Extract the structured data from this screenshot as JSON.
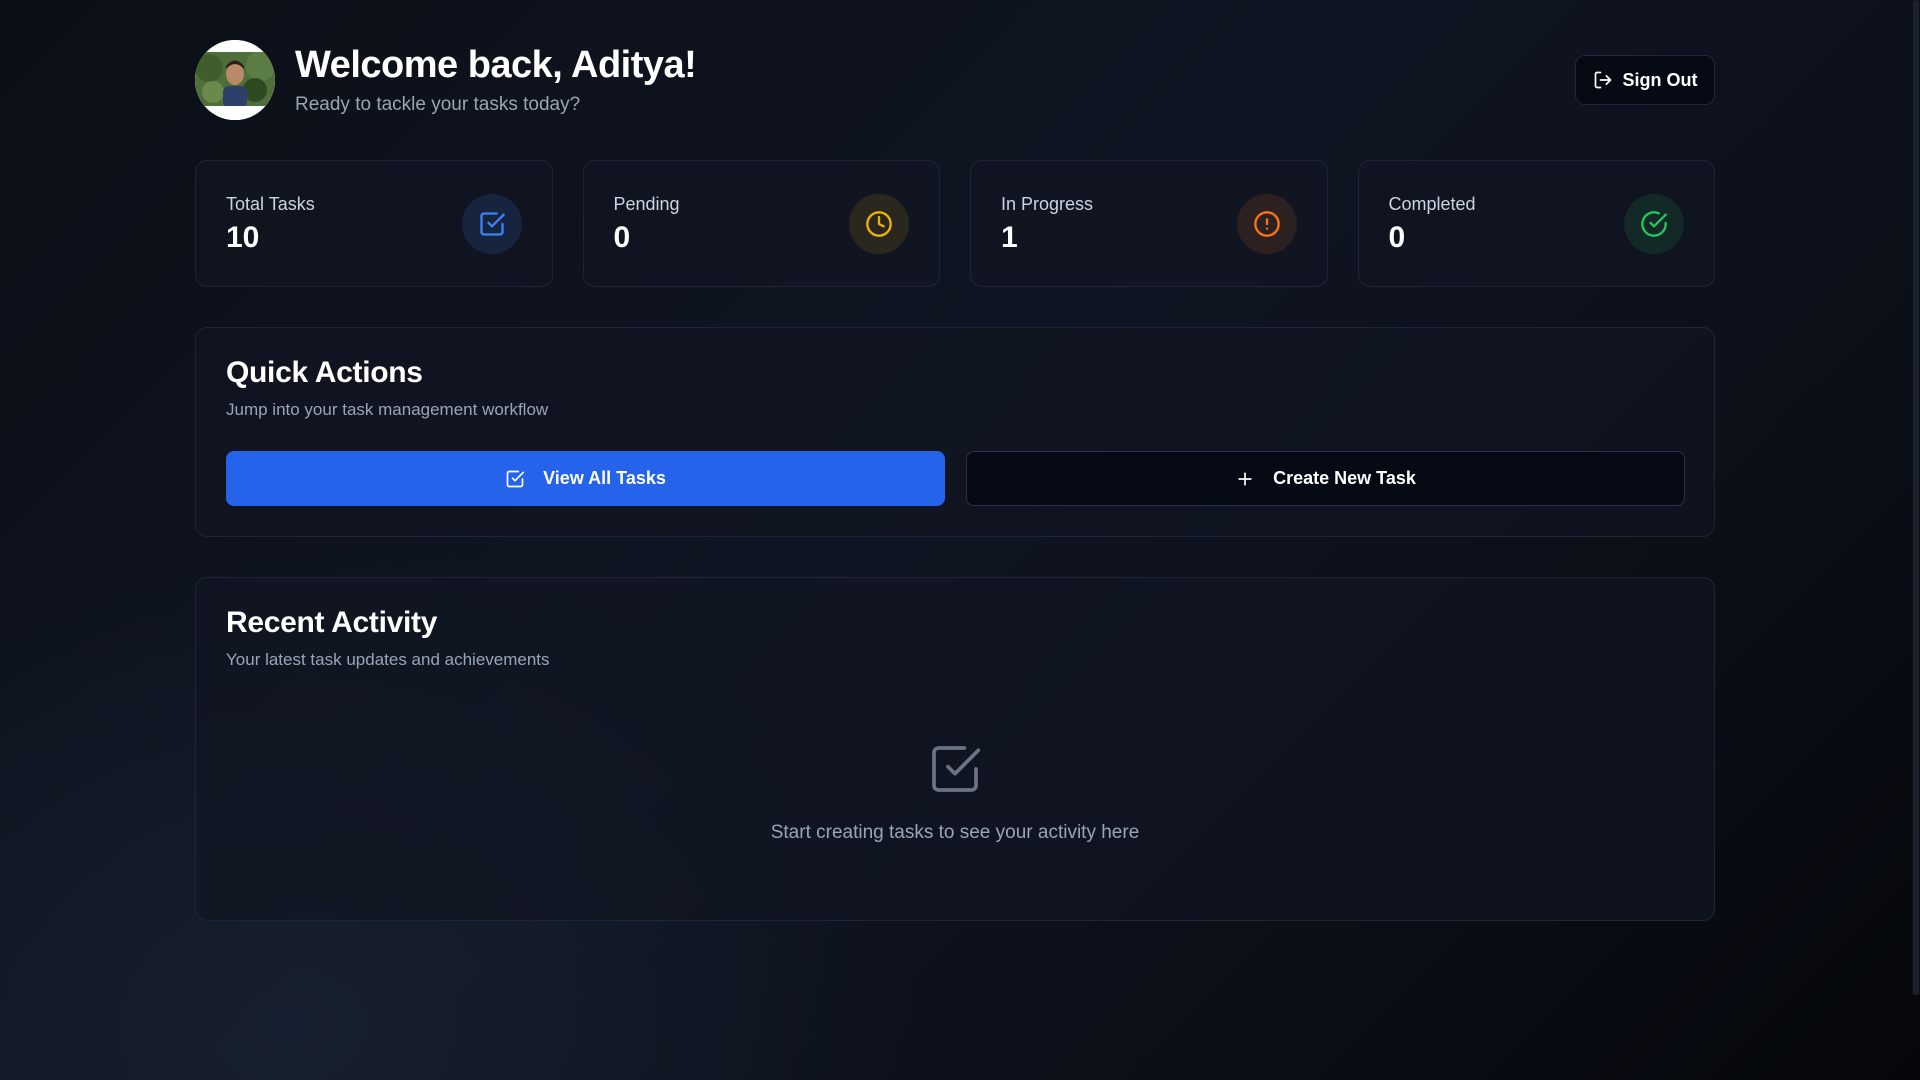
{
  "header": {
    "title": "Welcome back, Aditya!",
    "subtitle": "Ready to tackle your tasks today?",
    "sign_out_label": "Sign Out"
  },
  "stats": [
    {
      "label": "Total Tasks",
      "value": "10",
      "icon": "checkbox-icon",
      "color": "#3b82f6"
    },
    {
      "label": "Pending",
      "value": "0",
      "icon": "clock-icon",
      "color": "#eab308"
    },
    {
      "label": "In Progress",
      "value": "1",
      "icon": "alert-circle-icon",
      "color": "#f97316"
    },
    {
      "label": "Completed",
      "value": "0",
      "icon": "check-circle-icon",
      "color": "#22c55e"
    }
  ],
  "quick_actions": {
    "title": "Quick Actions",
    "subtitle": "Jump into your task management workflow",
    "view_all_label": "View All Tasks",
    "create_label": "Create New Task"
  },
  "recent_activity": {
    "title": "Recent Activity",
    "subtitle": "Your latest task updates and achievements",
    "empty_text": "Start creating tasks to see your activity here"
  },
  "colors": {
    "accent": "#2563eb",
    "background": "#0b0f17",
    "card": "#111622"
  }
}
